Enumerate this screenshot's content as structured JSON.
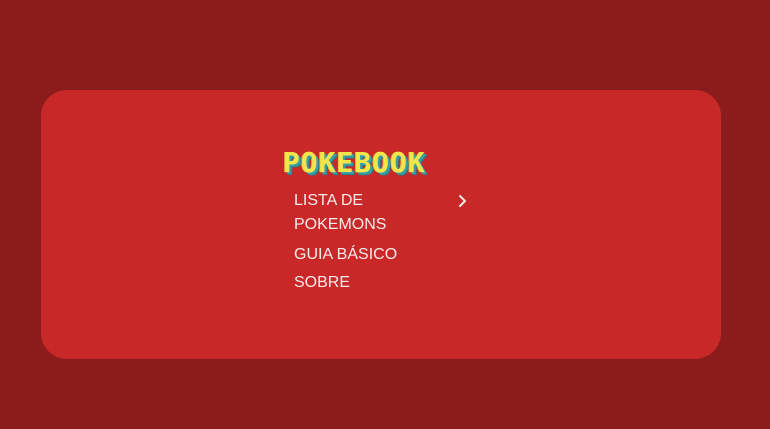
{
  "brand": {
    "title": "POKEBOOK"
  },
  "menu": {
    "items": [
      {
        "label": "LISTA DE POKEMONS",
        "icon": "chevron-right-icon"
      },
      {
        "label": "GUIA BÁSICO"
      },
      {
        "label": "SOBRE"
      }
    ]
  },
  "colors": {
    "page_background": "#8c1c1c",
    "card_background": "#c82828",
    "logo_yellow": "#f4e64a",
    "logo_shadow_teal": "#3aa0a8",
    "menu_text": "#f6eaea"
  }
}
